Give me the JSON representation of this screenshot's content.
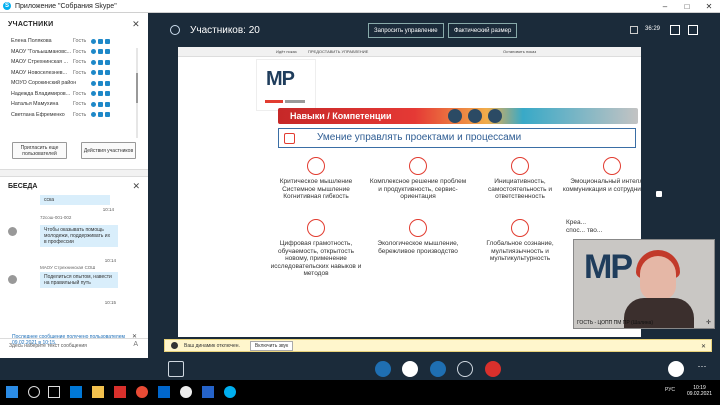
{
  "window": {
    "title": "Приложение \"Собрания Skype\"",
    "logo_letter": "S"
  },
  "participants": {
    "header": "УЧАСТНИКИ",
    "items": [
      {
        "name": "Елена Полякова",
        "role": "Гость"
      },
      {
        "name": "МАОУ \"Гольышмановс...",
        "role": "Гость"
      },
      {
        "name": "МАОУ Стрехнинская ...",
        "role": "Гость"
      },
      {
        "name": "МАОУ Новоселезнев...",
        "role": "Гость"
      },
      {
        "name": "МОУО Сорокинский район",
        "role": ""
      },
      {
        "name": "Надежда Владимиров...",
        "role": "Гость"
      },
      {
        "name": "Наталья Мамухина",
        "role": "Гость"
      },
      {
        "name": "Светлана Ефременко",
        "role": "Гость"
      }
    ],
    "invite_label": "Пригласить еще пользователей",
    "actions_label": "Действия участников"
  },
  "chat": {
    "header": "БЕСЕДА",
    "top_fragment": "сска",
    "messages": [
      {
        "sender": "",
        "text": "",
        "time": "10:14"
      },
      {
        "sender": "72сош-001-002",
        "text": "Чтобы оказывать помощь молодежи, поддерживать их в профессии",
        "time": "10:14"
      },
      {
        "sender": "МАОУ Стрехнинская СОШ",
        "text": "Поделиться опытом, навести на правильный путь",
        "time": "10:15"
      }
    ],
    "last_notice": "Последнее сообщение получено пользователем 09.02.2021 в 10:15.",
    "input_placeholder": "Здесь наберите текст сообщения"
  },
  "main": {
    "participants_title": "Участников: 20",
    "request_control": "Запросить управление",
    "actual_size": "Фактический размер",
    "timer": "36:29"
  },
  "slide": {
    "toolbar": {
      "tab1": "Идёт показ",
      "tab2": "ПРЕДОСТАВИТЬ УПРАВЛЕНИЕ",
      "tab3": "Остановить показ"
    },
    "logo": "МР",
    "band_label": "Навыки / Компетенции",
    "section_title": "Умение управлять проектами и процессами",
    "row1": [
      "Критическое мышление Системное мышление Когнитивная гибкость",
      "Комплексное решение проблем и продуктивность, сервис-ориентация",
      "Инициативность, самостоятельность и ответственность",
      "Эмоциональный интеллект, коммуникация и сотрудничество"
    ],
    "row2": [
      "Цифровая грамотность, обучаемость, открытость новому, применение исследовательских навыков и методов",
      "Экологическое мышление, бережливое производство",
      "Глобальное сознание, мультиязычность и мультикультурность",
      "Креа... спос... тво..."
    ],
    "webcam_caption": "ГОСТЬ - ЦОПП ПМ ПР (Шалина)",
    "webcam_logo": "МР"
  },
  "warn": {
    "text": "Ваш динамик отключен.",
    "button": "Включить звук"
  },
  "taskbar": {
    "lang": "РУС",
    "time": "10:19",
    "date": "09.02.2021"
  }
}
